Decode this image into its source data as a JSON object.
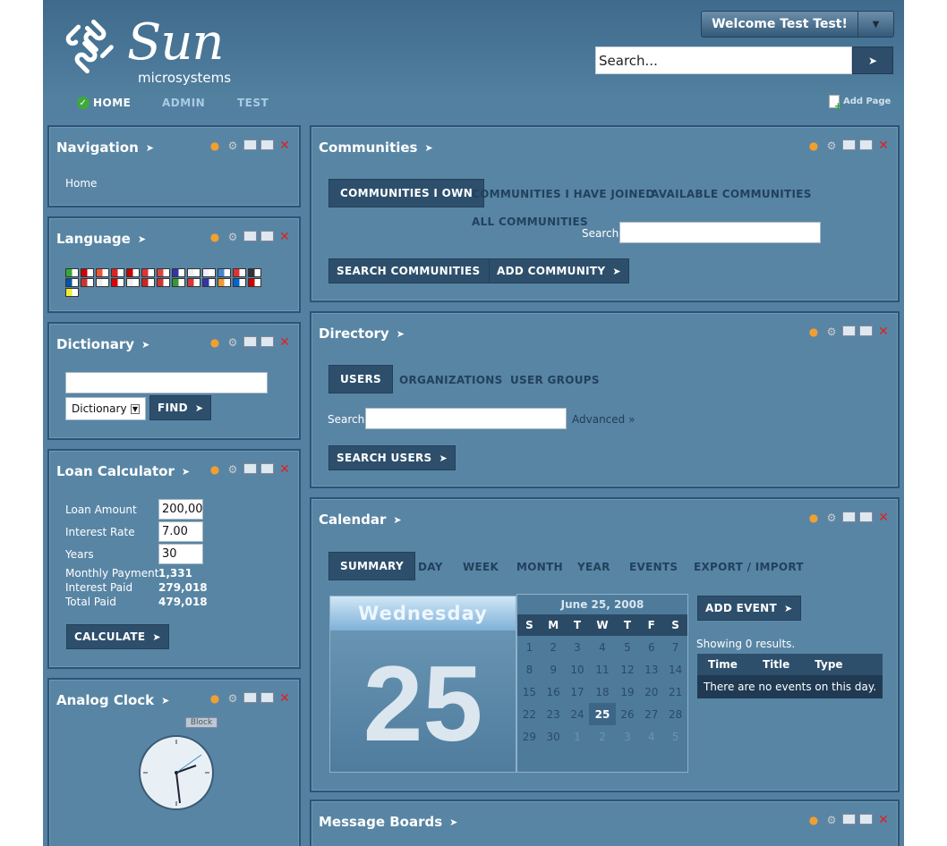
{
  "header": {
    "logo_word": "Sun",
    "logo_sub": "microsystems",
    "welcome": "Welcome Test Test!",
    "search_placeholder": "Search...",
    "nav": [
      "HOME",
      "ADMIN",
      "TEST"
    ],
    "add_page": "Add Page"
  },
  "navigation": {
    "title": "Navigation",
    "items": [
      "Home"
    ]
  },
  "language": {
    "title": "Language",
    "flag_colors": [
      "#3a3",
      "#c00",
      "#e53",
      "#d22",
      "#c00",
      "#d33",
      "#d44",
      "#33a",
      "#eee",
      "#eef",
      "#48c",
      "#d33",
      "#333",
      "#05a",
      "#c33",
      "#eee",
      "#d00",
      "#eee",
      "#c22",
      "#c33",
      "#393",
      "#d33",
      "#33a",
      "#e93",
      "#06c",
      "#c00",
      "#ee3"
    ]
  },
  "dictionary": {
    "title": "Dictionary",
    "select": "Dictionary",
    "find": "FIND"
  },
  "loan": {
    "title": "Loan Calculator",
    "labels": [
      "Loan Amount",
      "Interest Rate",
      "Years",
      "Monthly Payment",
      "Interest Paid",
      "Total Paid"
    ],
    "inputs": [
      "200,00",
      "7.00",
      "30"
    ],
    "results": [
      "1,331",
      "279,018",
      "479,018"
    ],
    "calc": "CALCULATE"
  },
  "clock": {
    "title": "Analog Clock",
    "tag": "Block"
  },
  "communities": {
    "title": "Communities",
    "tabs": [
      "COMMUNITIES I OWN",
      "COMMUNITIES I HAVE JOINED",
      "AVAILABLE COMMUNITIES",
      "ALL COMMUNITIES"
    ],
    "search_label": "Search",
    "btn_search": "SEARCH COMMUNITIES",
    "btn_add": "ADD COMMUNITY"
  },
  "directory": {
    "title": "Directory",
    "tabs": [
      "USERS",
      "ORGANIZATIONS",
      "USER GROUPS"
    ],
    "search_label": "Search",
    "advanced": "Advanced »",
    "btn": "SEARCH USERS"
  },
  "calendar": {
    "title": "Calendar",
    "tabs": [
      "SUMMARY",
      "DAY",
      "WEEK",
      "MONTH",
      "YEAR",
      "EVENTS",
      "EXPORT / IMPORT"
    ],
    "weekday": "Wednesday",
    "day": "25",
    "month_title": "June 25, 2008",
    "dow": [
      "S",
      "M",
      "T",
      "W",
      "T",
      "F",
      "S"
    ],
    "weeks": [
      [
        "1",
        "2",
        "3",
        "4",
        "5",
        "6",
        "7"
      ],
      [
        "8",
        "9",
        "10",
        "11",
        "12",
        "13",
        "14"
      ],
      [
        "15",
        "16",
        "17",
        "18",
        "19",
        "20",
        "21"
      ],
      [
        "22",
        "23",
        "24",
        "25",
        "26",
        "27",
        "28"
      ],
      [
        "29",
        "30",
        "1",
        "2",
        "3",
        "4",
        "5"
      ]
    ],
    "add_event": "ADD EVENT",
    "results": "Showing 0 results.",
    "cols": [
      "Time",
      "Title",
      "Type"
    ],
    "empty": "There are no events on this day."
  },
  "message_boards": {
    "title": "Message Boards"
  }
}
